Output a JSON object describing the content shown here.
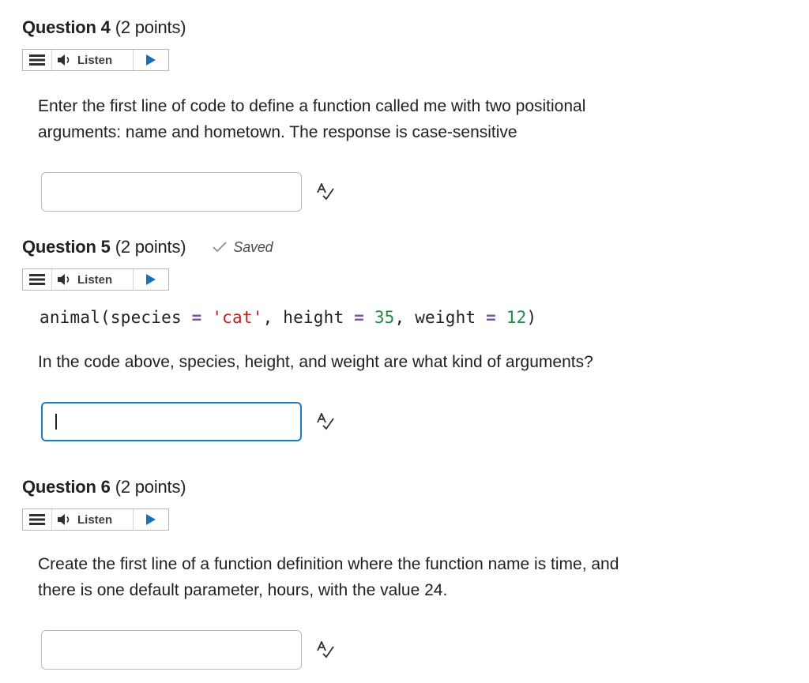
{
  "questions": [
    {
      "title": "Question 4",
      "points": "(2 points)",
      "listen_label": "Listen",
      "prompt_line1": "Enter the first line of code to define a function called me with two positional",
      "prompt_line2": "arguments: name and hometown.  The response is case-sensitive",
      "answer_value": ""
    },
    {
      "title": "Question 5",
      "points": "(2 points)",
      "saved_label": "Saved",
      "listen_label": "Listen",
      "code": {
        "t1": "animal(species ",
        "op1": "=",
        "s1": " ",
        "str1": "'cat'",
        "t2": ", height ",
        "op2": "=",
        "s2": " ",
        "num1": "35",
        "t3": ", weight ",
        "op3": "=",
        "s3": " ",
        "num2": "12",
        "t4": ")"
      },
      "prompt_line1": "In the code above, species, height, and weight are what kind of arguments?",
      "answer_value": ""
    },
    {
      "title": "Question 6",
      "points": "(2 points)",
      "listen_label": "Listen",
      "prompt_line1": "Create the first line of a function definition where the function name is time, and",
      "prompt_line2": "there is one default parameter, hours, with the value 24.",
      "answer_value": ""
    }
  ],
  "icons": {
    "menu": "hamburger-menu-icon",
    "speaker": "speaker-icon",
    "play": "play-icon",
    "check": "checkmark-icon",
    "spellcheck": "spellcheck-icon"
  },
  "colors": {
    "focus_border": "#1c7bc7",
    "input_border": "#b8bbbf"
  }
}
